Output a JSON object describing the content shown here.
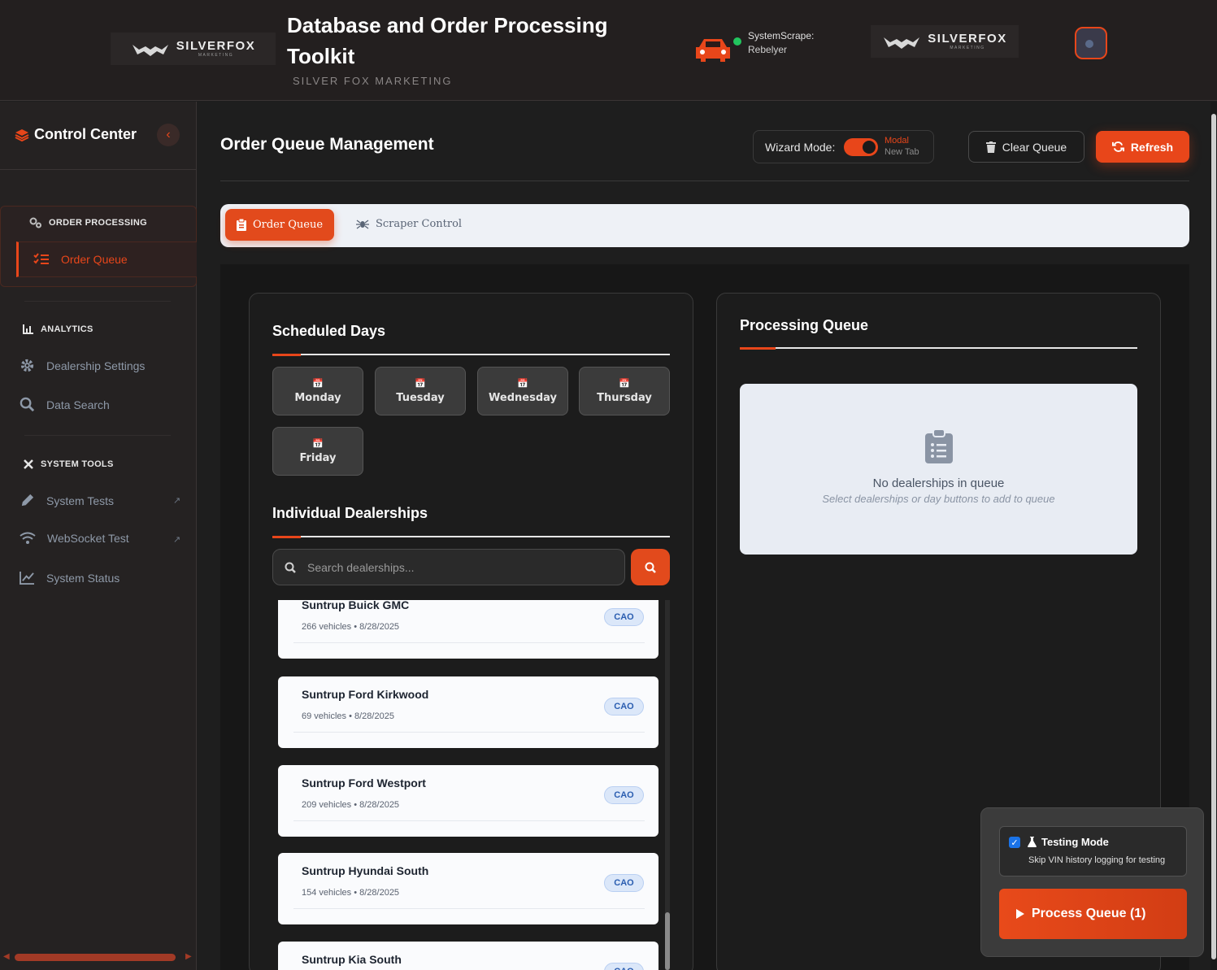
{
  "header": {
    "brand_text": "SILVERFOX",
    "brand_sub": "MARKETING",
    "title": "Database and Order Processing Toolkit",
    "subtitle": "SILVER FOX MARKETING",
    "status_line1": "SystemScrape:",
    "status_line2": "Rebelyer",
    "status_color": "#22c55e",
    "car_icon": "car-icon",
    "avatar_icon": "user-toggle-icon"
  },
  "sidebar": {
    "title": "Control Center",
    "sections": [
      {
        "label": "ORDER PROCESSING",
        "icon": "gears-icon",
        "items": [
          {
            "label": "Order Queue",
            "icon": "list-check-icon",
            "active": true
          }
        ]
      },
      {
        "label": "ANALYTICS",
        "icon": "chart-icon",
        "items": [
          {
            "label": "Dealership Settings",
            "icon": "gear-icon"
          },
          {
            "label": "Data Search",
            "icon": "search-icon"
          }
        ]
      },
      {
        "label": "SYSTEM TOOLS",
        "icon": "tools-icon",
        "items": [
          {
            "label": "System Tests",
            "icon": "pencil-icon",
            "external": true
          },
          {
            "label": "WebSocket Test",
            "icon": "wifi-icon",
            "external": true
          },
          {
            "label": "System Status",
            "icon": "line-chart-icon"
          }
        ]
      }
    ]
  },
  "main": {
    "title": "Order Queue Management",
    "wizard": {
      "label": "Wizard Mode:",
      "enabled": true,
      "option_active": "Modal",
      "option_inactive": "New Tab"
    },
    "clear_button": "Clear Queue",
    "refresh_button": "Refresh",
    "tabs": [
      {
        "label": "Order Queue",
        "icon": "clipboard-icon",
        "active": true
      },
      {
        "label": "Scraper Control",
        "icon": "spider-icon",
        "active": false
      }
    ]
  },
  "scheduled": {
    "heading": "Scheduled Days",
    "days": [
      "Monday",
      "Tuesday",
      "Wednesday",
      "Thursday",
      "Friday"
    ]
  },
  "dealerships": {
    "heading": "Individual Dealerships",
    "search_placeholder": "Search dealerships...",
    "items": [
      {
        "name": "Suntrup Buick GMC",
        "meta": "266 vehicles • 8/28/2025",
        "tag": "CAO"
      },
      {
        "name": "Suntrup Ford Kirkwood",
        "meta": "69 vehicles • 8/28/2025",
        "tag": "CAO"
      },
      {
        "name": "Suntrup Ford Westport",
        "meta": "209 vehicles • 8/28/2025",
        "tag": "CAO"
      },
      {
        "name": "Suntrup Hyundai South",
        "meta": "154 vehicles • 8/28/2025",
        "tag": "CAO"
      },
      {
        "name": "Suntrup Kia South",
        "meta": "",
        "tag": "CAO"
      }
    ]
  },
  "queue": {
    "heading": "Processing Queue",
    "empty_title": "No dealerships in queue",
    "empty_sub": "Select dealerships or day buttons to add to queue"
  },
  "actions": {
    "testing_label": "Testing Mode",
    "testing_checked": true,
    "testing_sub": "Skip VIN history logging for testing",
    "process_button": "Process Queue (1)"
  },
  "colors": {
    "accent": "#e8461a",
    "tag_bg": "#dbe7f9",
    "tag_text": "#2a5db0"
  }
}
